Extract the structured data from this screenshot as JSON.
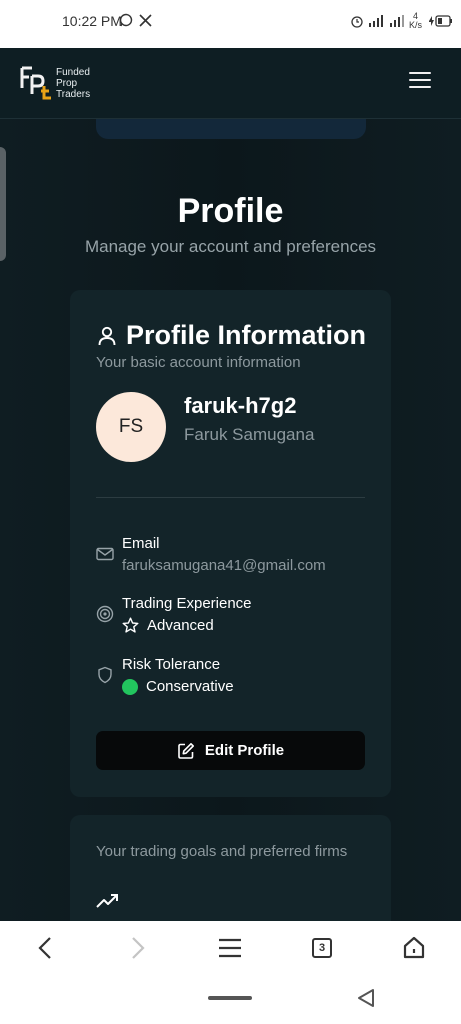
{
  "status_bar": {
    "time": "10:22 PM",
    "apps": "◔𝕏",
    "net_speed_value": "4",
    "net_speed_unit": "K/s"
  },
  "header": {
    "logo_lines": [
      "Funded",
      "Prop",
      "Traders"
    ],
    "brand_accent": "#e8a317"
  },
  "page": {
    "title": "Profile",
    "subtitle": "Manage your account and preferences"
  },
  "profile_card": {
    "title": "Profile Information",
    "description": "Your basic account information",
    "avatar_initials": "FS",
    "username": "faruk-h7g2",
    "full_name": "Faruk Samugana",
    "fields": [
      {
        "label": "Email",
        "value": "faruksamugana41@gmail.com",
        "icon": "mail-icon"
      },
      {
        "label": "Trading Experience",
        "value": "Advanced",
        "icon": "target-icon"
      },
      {
        "label": "Risk Tolerance",
        "value": "Conservative",
        "icon": "shield-icon"
      }
    ],
    "edit_button": "Edit Profile"
  },
  "goals_card": {
    "description": "Your trading goals and preferred firms"
  },
  "browser_bar": {
    "tabs_count": "3"
  },
  "colors": {
    "background": "#0e1e23",
    "card": "#132429",
    "success": "#22c55e"
  }
}
